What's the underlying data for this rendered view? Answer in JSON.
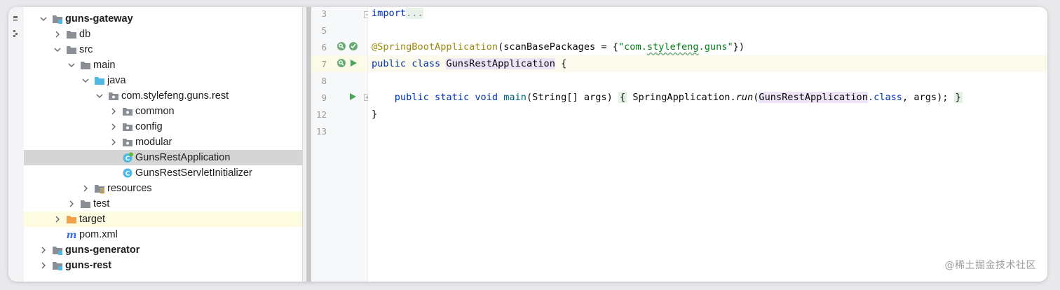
{
  "project_tree": {
    "items": [
      {
        "label": "guns-gateway",
        "bold": true
      },
      {
        "label": "db"
      },
      {
        "label": "src"
      },
      {
        "label": "main"
      },
      {
        "label": "java"
      },
      {
        "label": "com.stylefeng.guns.rest"
      },
      {
        "label": "common"
      },
      {
        "label": "config"
      },
      {
        "label": "modular"
      },
      {
        "label": "GunsRestApplication",
        "selected": true
      },
      {
        "label": "GunsRestServletInitializer"
      },
      {
        "label": "resources"
      },
      {
        "label": "test"
      },
      {
        "label": "target"
      },
      {
        "label": "pom.xml"
      },
      {
        "label": "guns-generator",
        "bold": true
      },
      {
        "label": "guns-rest",
        "bold": true
      }
    ]
  },
  "editor": {
    "line_numbers": [
      "3",
      "5",
      "6",
      "7",
      "8",
      "9",
      "12",
      "13"
    ],
    "code": {
      "l3_import": "import",
      "l3_fold": "...",
      "l6_annotation": "@SpringBootApplication",
      "l6_open": "(scanBasePackages = {",
      "l6_string_q1": "\"",
      "l6_string_a": "com.",
      "l6_string_b": "stylefeng",
      "l6_string_c": ".guns",
      "l6_string_q2": "\"",
      "l6_close": "})",
      "l7_kw": "public class ",
      "l7_class": "GunsRestApplication",
      "l7_brace": " {",
      "l9_indent": "    ",
      "l9_kw": "public static void ",
      "l9_fn": "main",
      "l9_params": "(String[] args) ",
      "l9_open": "{",
      "l9_body1": " SpringApplication.",
      "l9_run": "run",
      "l9_paren": "(",
      "l9_cls": "GunsRestApplication",
      "l9_dotclass": ".class",
      "l9_args": ", args); ",
      "l9_close": "}",
      "l12": "}"
    }
  },
  "watermark": "@稀土掘金技术社区",
  "colors": {
    "keyword": "#0033b3",
    "annotation": "#9e880d",
    "string": "#067d17",
    "method": "#00627a",
    "selection": "#d5d5d5",
    "folder": "#8a8f96",
    "source_folder": "#4fb8e5",
    "target_folder": "#f0a04b"
  }
}
